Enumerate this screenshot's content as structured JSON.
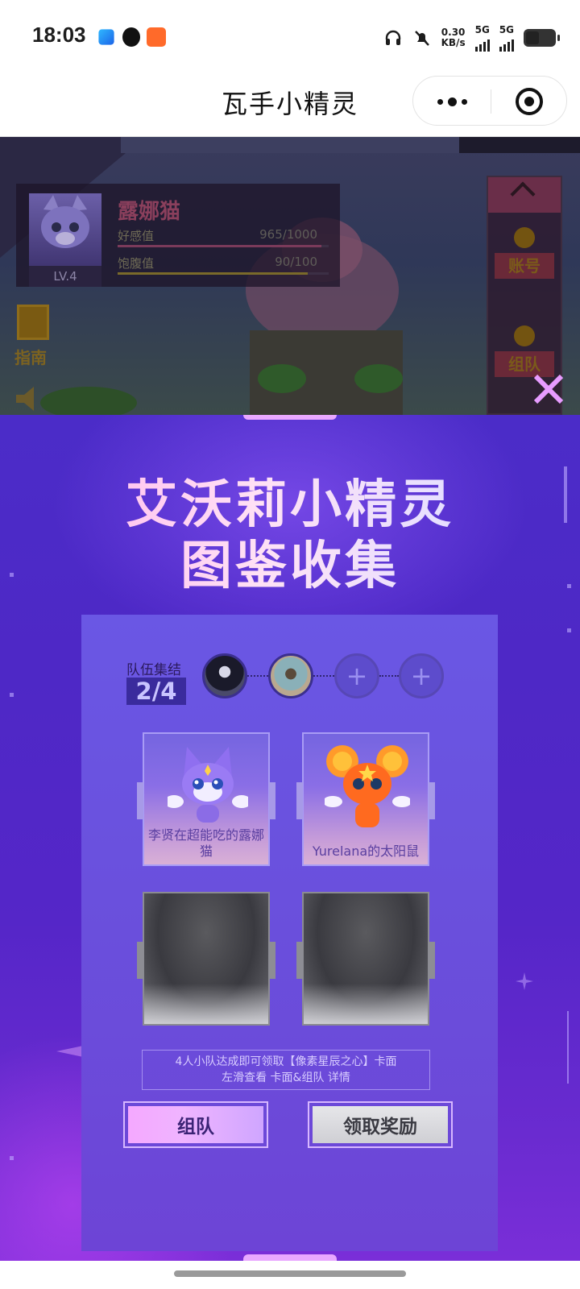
{
  "status_bar": {
    "time": "18:03",
    "net_speed_value": "0.30",
    "net_speed_unit": "KB/s",
    "sim1": "5G",
    "sim2": "5G",
    "icons": [
      "app-icon-blue",
      "qq-icon",
      "app-icon-orange",
      "headphones-icon",
      "mute-icon",
      "signal-icon",
      "battery-icon"
    ]
  },
  "title_bar": {
    "title": "瓦手小精灵"
  },
  "game": {
    "pet_name": "露娜猫",
    "pet_level": "LV.4",
    "favor_label": "好感值",
    "favor_value": "965/1000",
    "favor_progress": 0.965,
    "satiety_label": "饱腹值",
    "satiety_value": "90/100",
    "satiety_progress": 0.9,
    "guide_label": "指南",
    "account_label": "账号",
    "team_label": "组队"
  },
  "modal": {
    "title_line1": "艾沃莉小精灵",
    "title_line2": "图鉴收集",
    "team_gather_label": "队伍集结",
    "team_count": "2/4",
    "add_member": "+",
    "cards": [
      {
        "name": "李贤在超能吃的露娜猫",
        "collected": true
      },
      {
        "name": "Yurelana的太阳鼠",
        "collected": true
      },
      {
        "name": "",
        "collected": false
      },
      {
        "name": "",
        "collected": false
      }
    ],
    "info_line1": "4人小队达成即可领取【像素星辰之心】卡面",
    "info_line2": "左滑查看 卡面&组队 详情",
    "team_button": "组队",
    "reward_button": "领取奖励"
  },
  "colors": {
    "modal_purple": "#4e28c6",
    "title_pink": "#ffb2ec",
    "close_x": "#e79cff"
  }
}
